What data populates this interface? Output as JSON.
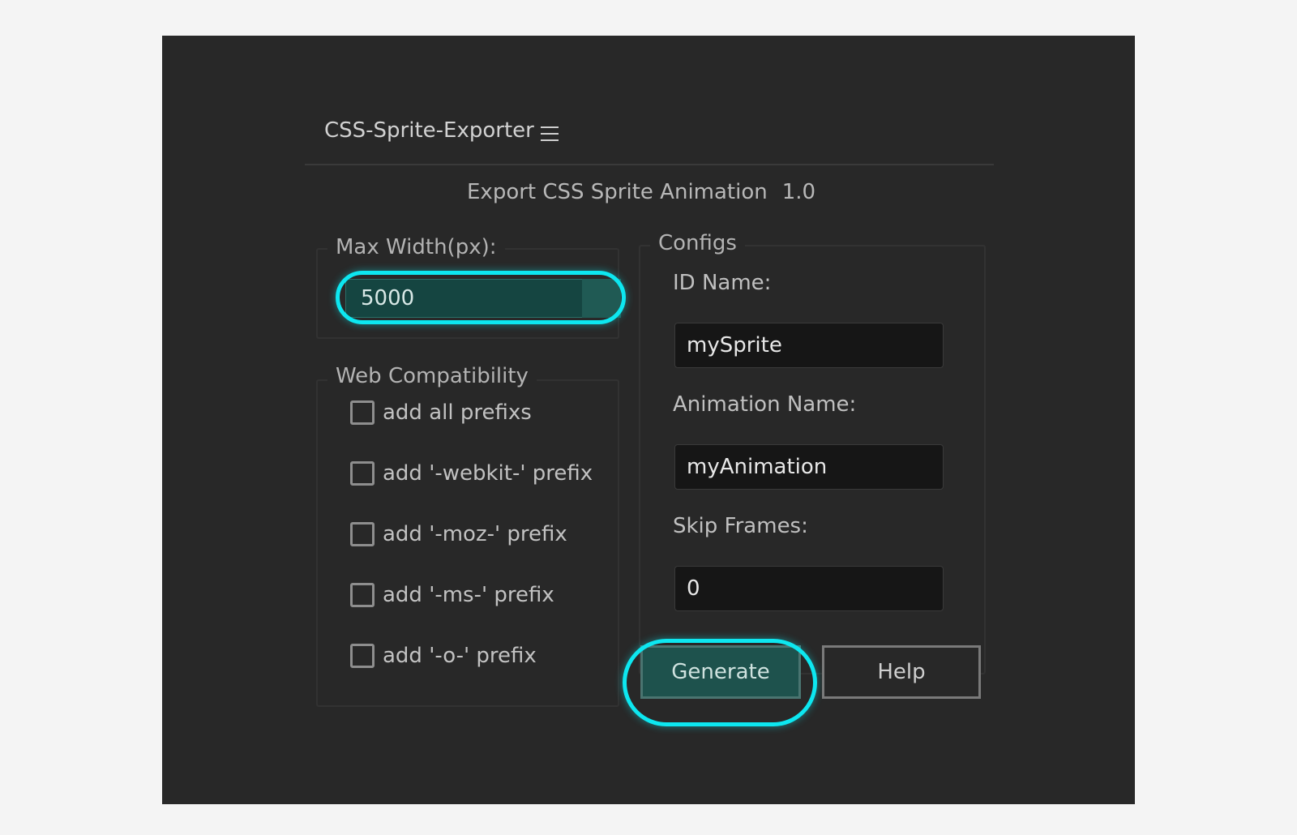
{
  "header": {
    "title": "CSS-Sprite-Exporter",
    "menu_icon": "hamburger-menu-icon"
  },
  "subtitle": {
    "text": "Export CSS Sprite Animation",
    "version": "1.0"
  },
  "max_width": {
    "legend": "Max Width(px):",
    "value": "5000"
  },
  "web_compatibility": {
    "legend": "Web Compatibility",
    "options": [
      {
        "label": "add all prefixs",
        "checked": false
      },
      {
        "label": "add '-webkit-' prefix",
        "checked": false
      },
      {
        "label": "add '-moz-' prefix",
        "checked": false
      },
      {
        "label": "add '-ms-' prefix",
        "checked": false
      },
      {
        "label": "add '-o-' prefix",
        "checked": false
      }
    ]
  },
  "configs": {
    "legend": "Configs",
    "id_name": {
      "label": "ID Name:",
      "value": "mySprite"
    },
    "animation_name": {
      "label": "Animation Name:",
      "value": "myAnimation"
    },
    "skip_frames": {
      "label": "Skip Frames:",
      "value": "0"
    }
  },
  "buttons": {
    "generate": "Generate",
    "help": "Help"
  },
  "colors": {
    "panel_bg": "#282828",
    "accent_teal": "#154541",
    "highlight_cyan": "#0de7f0",
    "page_bg": "#f4f4f4"
  }
}
